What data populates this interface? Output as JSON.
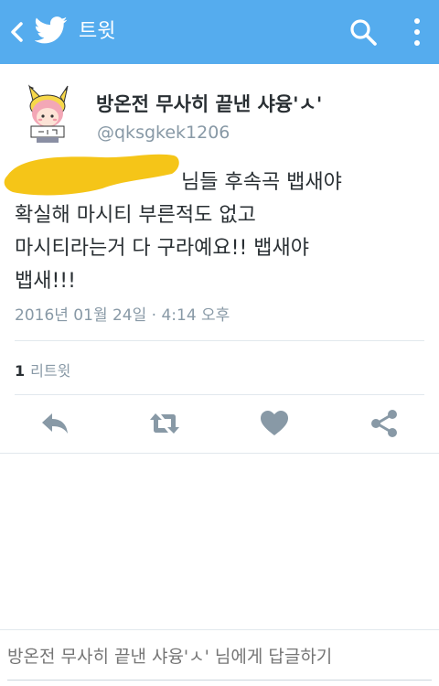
{
  "header": {
    "title": "트윗",
    "bg_color": "#55acee"
  },
  "tweet": {
    "display_name": "방온전 무사히 끝낸 샤융'ㅅ'",
    "handle": "@qksgkek1206",
    "text_line1_visible": "님들 후속곡 뱁새야",
    "text_rest": "확실해 마시티 부른적도 없고\n마시티라는거 다 구라예요!! 뱁새야\n뱁새!!!",
    "redaction_color": "#f5c518",
    "timestamp": "2016년 01월 24일 · 4:14 오후",
    "retweet_count": "1",
    "retweet_label": "리트윗"
  },
  "actions": {
    "reply": "reply-icon",
    "retweet": "retweet-icon",
    "like": "heart-icon",
    "share": "share-icon"
  },
  "reply_box": {
    "placeholder": "방온전 무사히 끝낸 샤융'ㅅ' 님에게 답글하기"
  }
}
